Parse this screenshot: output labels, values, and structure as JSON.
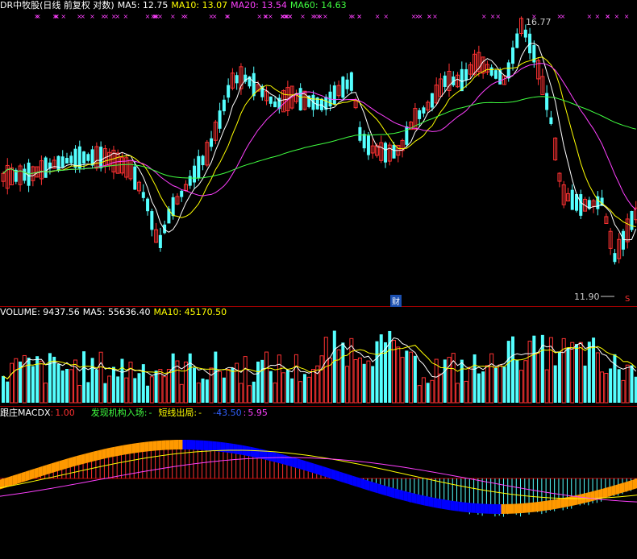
{
  "price_panel": {
    "title": "DR中牧股(日线 前复权 对数)",
    "ma_labels": [
      {
        "text": "MA5: 12.75",
        "color": "#ffffff"
      },
      {
        "text": "MA10: 13.07",
        "color": "#ffff00"
      },
      {
        "text": "MA20: 13.54",
        "color": "#ff40ff"
      },
      {
        "text": "MA60: 14.63",
        "color": "#40ff40"
      }
    ],
    "high_label": "16.77",
    "low_label": "11.90",
    "fin_badge": "财",
    "s_badge": "S"
  },
  "volume_panel": {
    "label_name": "VOLUME: 9437.56",
    "label_ma5": "MA5: 55636.40",
    "label_ma10": "MA10: 45170.50"
  },
  "macd_panel": {
    "name": "跟庄MACDX",
    "sep1": ":",
    "v1": "1.00",
    "l2": "发现机构入场:",
    "v2": "-",
    "l3": "短线出局:",
    "v3": "-",
    "v4": "-43.50",
    "sep5": ":",
    "v5": "5.95"
  },
  "colors": {
    "up": "#ff3232",
    "down": "#54ffff",
    "ma5": "#ffffff",
    "ma10": "#ffff00",
    "ma20": "#ff40ff",
    "ma60": "#40ff40",
    "orange": "#ff9900",
    "blue": "#0000ff",
    "divider": "#a00000"
  }
}
